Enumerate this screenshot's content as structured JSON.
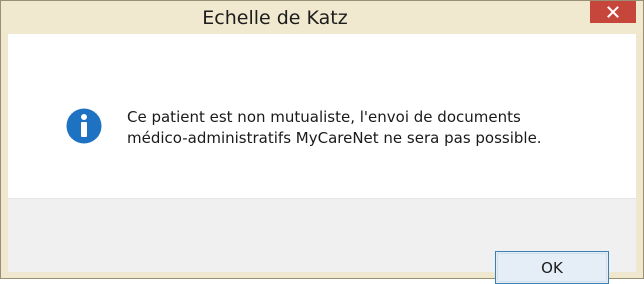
{
  "window": {
    "title": "Echelle de Katz",
    "close_icon": "close-icon"
  },
  "message": {
    "icon": "info-icon",
    "line1": "Ce patient est non mutualiste, l'envoi de documents",
    "line2": "médico-administratifs MyCareNet ne sera pas possible."
  },
  "buttons": {
    "ok_label": "OK"
  },
  "colors": {
    "title_bar": "#f0e8cf",
    "close_button": "#c7463b",
    "info_icon": "#1d73c1",
    "button_border": "#3c7fb1"
  }
}
